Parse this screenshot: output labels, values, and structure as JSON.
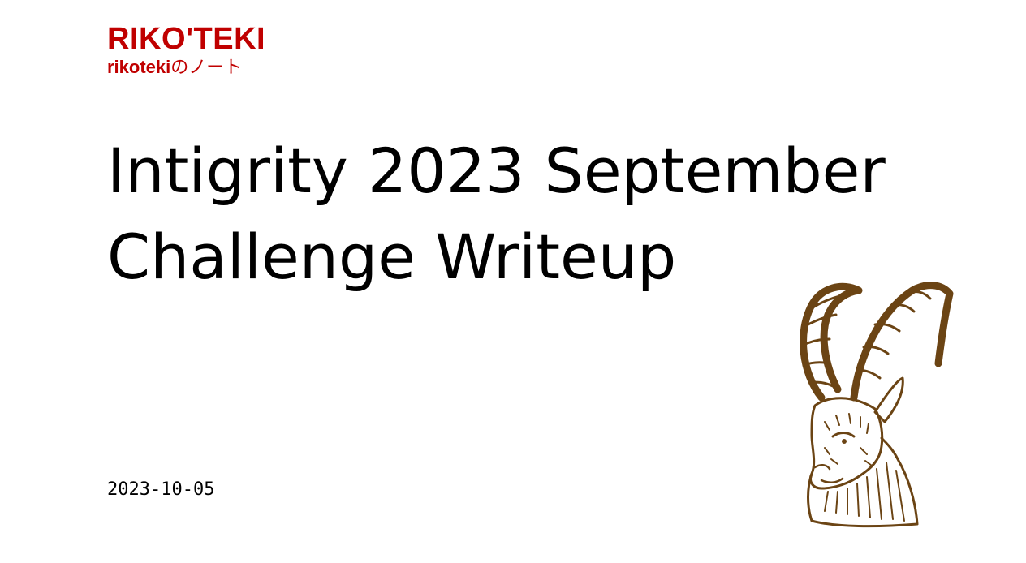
{
  "brand": {
    "name": "RIKO'TEKI",
    "tagline_bold": "rikoteki",
    "tagline_rest": "のノート",
    "color": "#c00000"
  },
  "post": {
    "title": "Intigrity 2023 September Challenge Writeup",
    "date": "2023-10-05"
  },
  "illustration": {
    "icon": "ibex-icon",
    "color": "#6b4414"
  }
}
